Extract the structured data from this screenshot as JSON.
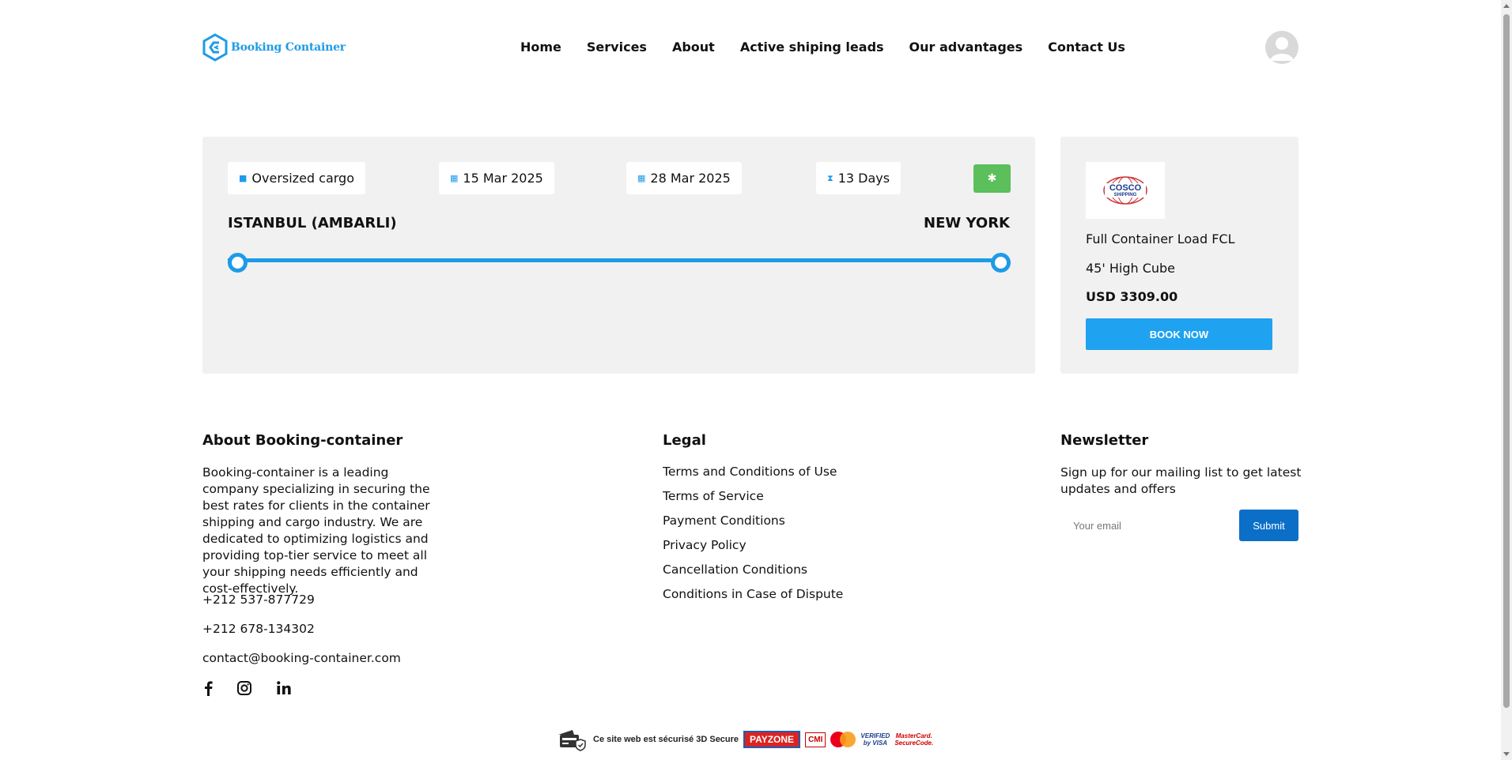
{
  "header": {
    "logo_text": "Booking Container",
    "nav": [
      "Home",
      "Services",
      "About",
      "Active shiping leads",
      "Our advantages",
      "Contact Us"
    ]
  },
  "route": {
    "cargo_type": "Oversized cargo",
    "departure_date": "15 Mar 2025",
    "arrival_date": "28 Mar 2025",
    "duration": "13 Days",
    "origin": "ISTANBUL (AMBARLI)",
    "destination": "NEW YORK",
    "colors": {
      "accent": "#1e9be8",
      "flag_button": "#5bbf5b"
    }
  },
  "offer": {
    "carrier_logo_text": [
      "COSCO",
      "SHIPPING"
    ],
    "load_type": "Full Container Load FCL",
    "container": "45' High Cube",
    "price": "USD 3309.00",
    "book_label": "BOOK NOW"
  },
  "footer": {
    "about": {
      "title": "About Booking-container",
      "text": "Booking-container is a leading company specializing in securing the best rates for clients in the container shipping and cargo industry. We are dedicated to optimizing logistics and providing top-tier service to meet all your shipping needs efficiently and cost-effectively.",
      "phone1": "+212 537-877729",
      "phone2": "+212 678-134302",
      "email": "contact@booking-container.com"
    },
    "legal": {
      "title": "Legal",
      "links": [
        "Terms and Conditions of Use",
        "Terms of Service",
        "Payment Conditions",
        "Privacy Policy",
        "Cancellation Conditions",
        "Conditions in Case of Dispute"
      ]
    },
    "newsletter": {
      "title": "Newsletter",
      "text": "Sign up for our mailing list to get latest updates and offers",
      "placeholder": "Your email",
      "submit_label": "Submit"
    },
    "secure": {
      "text": "Ce site web est sécurisé 3D Secure",
      "payzone": "PAYZONE",
      "cmi": "CMI",
      "visa": [
        "VERIFIED",
        "by VISA"
      ],
      "mastercard": [
        "MasterCard.",
        "SecureCode."
      ]
    }
  }
}
